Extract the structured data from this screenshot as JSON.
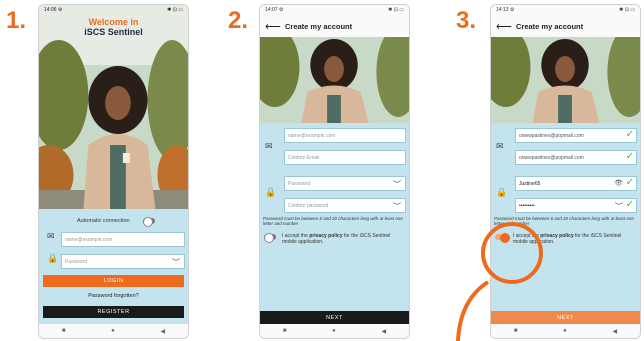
{
  "steps": [
    "1.",
    "2.",
    "3."
  ],
  "screen1": {
    "status_time": "14:06 ⚙",
    "status_icons": "✱ ⊡ ▭",
    "welcome_line1": "Welcome in",
    "welcome_line2": "iSCS Sentinel",
    "auto_connection_label": "Automatic connection",
    "email_placeholder": "name@example.com",
    "password_placeholder": "Password",
    "login_label": "LOGIN",
    "forgot_label": "Password forgotten?",
    "register_label": "REGISTER"
  },
  "screen2": {
    "status_time": "14:07 ⚙",
    "status_icons": "✱ ⊡ ▭",
    "title": "Create my account",
    "email_placeholder": "name@example.com",
    "confirm_email_placeholder": "Confirm Email",
    "password_placeholder": "Password",
    "confirm_password_placeholder": "Confirm password",
    "password_rule": "Password must be between 6 and 20 characters long with at least one letter and number",
    "privacy_text_pre": "I accept the ",
    "privacy_text_bold": "privacy policy",
    "privacy_text_post": " for the iSCS Sentinel mobile application.",
    "next_label": "NEXT"
  },
  "screen3": {
    "status_time": "14:13 ⚙",
    "status_icons": "✱ ⊡ ▭",
    "title": "Create my account",
    "email_value": "oowwpastines@popmail.com",
    "confirm_email_value": "oowwpastines@popmail.com",
    "password_value": "Justine65",
    "confirm_password_value": "•••••••••",
    "password_rule": "Password must be between 6 and 20 characters long with at least one letter and number",
    "privacy_text_pre": "I accept the ",
    "privacy_text_bold": "privacy policy",
    "privacy_text_post": " for the iSCS Sentinel mobile application.",
    "next_label": "NEXT"
  },
  "colors": {
    "accent": "#ee6b1e",
    "panel": "#c3e4ee",
    "dark": "#1a1a1a"
  }
}
